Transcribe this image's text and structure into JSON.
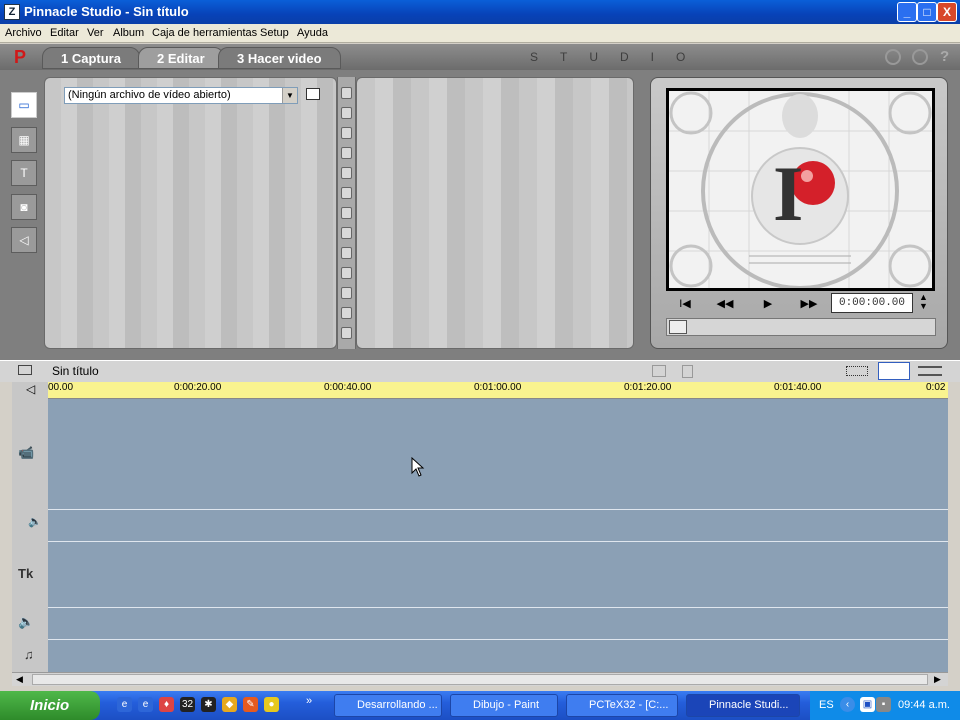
{
  "window": {
    "title": "Pinnacle Studio - Sin título",
    "app_icon": "Z"
  },
  "window_controls": {
    "minimize": "_",
    "maximize": "□",
    "close": "X"
  },
  "menu": [
    "Archivo",
    "Editar",
    "Ver",
    "Album",
    "Caja de herramientas",
    "Setup",
    "Ayuda"
  ],
  "mode_tabs": {
    "logo": "P",
    "tabs": [
      "1 Captura",
      "2 Editar",
      "3 Hacer video"
    ],
    "active": 1,
    "brand": "STUDIO",
    "help": "?"
  },
  "album": {
    "video_select_value": "(Ningún archivo de vídeo abierto)",
    "tool_icons": [
      "video-camera-icon",
      "transitions-icon",
      "titles-icon",
      "photos-icon",
      "sound-effects-icon"
    ]
  },
  "player": {
    "buttons": {
      "to_start": "I◀",
      "rewind": "◀◀",
      "play": "▶",
      "fast_forward": "▶▶"
    },
    "timecode": "0:00:00.00",
    "screen_letter": "I"
  },
  "timeline": {
    "project_name": "Sin título",
    "ruler_ticks": [
      "00.00",
      "0:00:20.00",
      "0:00:40.00",
      "0:01:00.00",
      "0:01:20.00",
      "0:01:40.00",
      "0:02"
    ],
    "track_icons": [
      "video-track-icon",
      "audio-track-icon",
      "title-track-icon",
      "sound-effect-track-icon",
      "music-track-icon"
    ],
    "track_glyphs": {
      "video": "📹",
      "audio": "🔈",
      "title": "Tk",
      "sfx": "🔈",
      "music": "♫"
    }
  },
  "taskbar": {
    "start_label": "Inicio",
    "tasks": [
      {
        "label": "Desarrollando ...",
        "active": false
      },
      {
        "label": "Dibujo - Paint",
        "active": false
      },
      {
        "label": "PCTeX32 - [C:...",
        "active": false
      },
      {
        "label": "Pinnacle Studi...",
        "active": true
      }
    ],
    "language": "ES",
    "clock": "09:44 a.m.",
    "overflow": "»"
  },
  "colors": {
    "title_bar": "#0842b8",
    "ruler": "#f9f38f",
    "timeline_bg": "#8ba0b5",
    "taskbar": "#245edb",
    "start": "#2e8b2a"
  }
}
